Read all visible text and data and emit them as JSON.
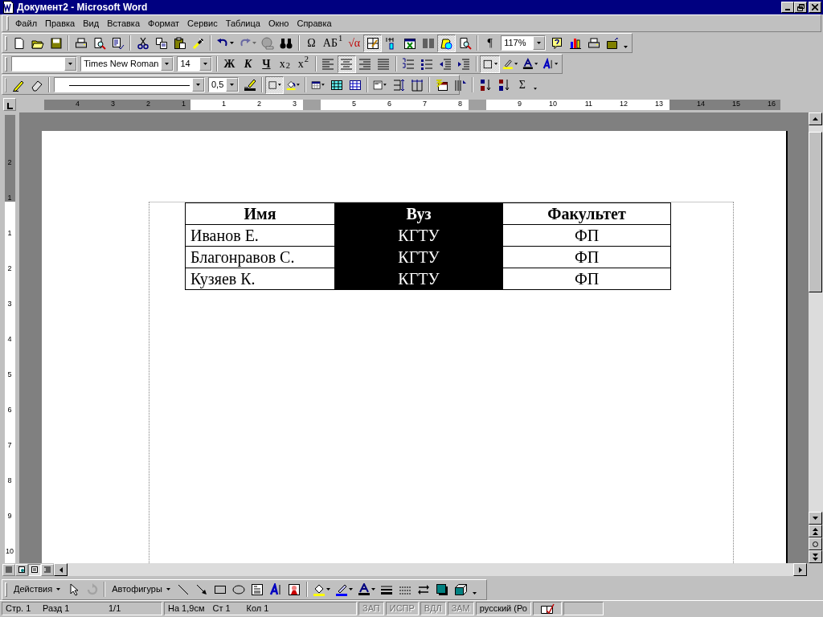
{
  "window": {
    "title": "Документ2 - Microsoft Word"
  },
  "menu": [
    {
      "label": "Файл"
    },
    {
      "label": "Правка"
    },
    {
      "label": "Вид"
    },
    {
      "label": "Вставка"
    },
    {
      "label": "Формат"
    },
    {
      "label": "Сервис"
    },
    {
      "label": "Таблица"
    },
    {
      "label": "Окно"
    },
    {
      "label": "Справка"
    }
  ],
  "toolbars": [
    {
      "items": [
        {
          "kind": "button",
          "pressed": false,
          "disabled": false
        },
        {
          "kind": "button",
          "pressed": false,
          "disabled": false
        },
        {
          "kind": "button",
          "pressed": false,
          "disabled": false
        },
        {
          "kind": "separator"
        },
        {
          "kind": "button",
          "pressed": false,
          "disabled": false
        },
        {
          "kind": "button",
          "pressed": false,
          "disabled": false
        },
        {
          "kind": "button",
          "pressed": false,
          "disabled": false
        },
        {
          "kind": "separator"
        },
        {
          "kind": "button",
          "pressed": false,
          "disabled": false
        },
        {
          "kind": "button",
          "pressed": false,
          "disabled": false
        },
        {
          "kind": "button",
          "pressed": false,
          "disabled": false
        },
        {
          "kind": "button",
          "pressed": false,
          "disabled": false
        },
        {
          "kind": "separator"
        },
        {
          "kind": "split",
          "pressed": false,
          "disabled": false
        },
        {
          "kind": "split",
          "pressed": false,
          "disabled": true
        },
        {
          "kind": "button",
          "pressed": false,
          "disabled": true
        },
        {
          "kind": "button",
          "pressed": false,
          "disabled": false
        },
        {
          "kind": "separator"
        },
        {
          "kind": "text-button",
          "label": "Ω",
          "pressed": false,
          "disabled": false
        },
        {
          "kind": "text-button",
          "label": "АБ$^{1}$",
          "pressed": false,
          "disabled": false
        },
        {
          "kind": "text-button",
          "label": "√α",
          "pressed": false,
          "disabled": false
        },
        {
          "kind": "button",
          "pressed": true,
          "disabled": false
        },
        {
          "kind": "button",
          "pressed": false,
          "disabled": false
        },
        {
          "kind": "button",
          "pressed": false,
          "disabled": false
        },
        {
          "kind": "button",
          "pressed": false,
          "disabled": false
        },
        {
          "kind": "button",
          "pressed": true,
          "disabled": false
        },
        {
          "kind": "button",
          "pressed": false,
          "disabled": false
        },
        {
          "kind": "separator"
        },
        {
          "kind": "text-button",
          "label": "¶",
          "pressed": false,
          "disabled": false
        },
        {
          "kind": "combo",
          "value": "117%"
        },
        {
          "kind": "button",
          "pressed": false,
          "disabled": false
        },
        {
          "kind": "button",
          "pressed": false,
          "disabled": false
        },
        {
          "kind": "button",
          "pressed": false,
          "disabled": false
        },
        {
          "kind": "button",
          "pressed": false,
          "disabled": false
        },
        {
          "kind": "more"
        }
      ]
    },
    {
      "items": [
        {
          "kind": "combo"
        },
        {
          "kind": "combo",
          "value": "Times New Roman"
        },
        {
          "kind": "combo",
          "value": "14"
        },
        {
          "kind": "separator"
        },
        {
          "kind": "text-button",
          "label": "Ж",
          "pressed": false,
          "disabled": false
        },
        {
          "kind": "text-button",
          "label": "К",
          "pressed": false,
          "disabled": false
        },
        {
          "kind": "text-button",
          "label": "Ч",
          "pressed": false,
          "disabled": false
        },
        {
          "kind": "text-button",
          "label": "x$_{2}$",
          "pressed": false,
          "disabled": false
        },
        {
          "kind": "text-button",
          "label": "x$^{2}$",
          "pressed": false,
          "disabled": false
        },
        {
          "kind": "separator"
        },
        {
          "kind": "button",
          "pressed": false,
          "disabled": false
        },
        {
          "kind": "button",
          "pressed": true,
          "disabled": false
        },
        {
          "kind": "button",
          "pressed": false,
          "disabled": false
        },
        {
          "kind": "button",
          "pressed": false,
          "disabled": false
        },
        {
          "kind": "separator"
        },
        {
          "kind": "button",
          "pressed": false,
          "disabled": false
        },
        {
          "kind": "button",
          "pressed": false,
          "disabled": false
        },
        {
          "kind": "button",
          "pressed": false,
          "disabled": false
        },
        {
          "kind": "button",
          "pressed": false,
          "disabled": false
        },
        {
          "kind": "separator"
        },
        {
          "kind": "split",
          "pressed": true,
          "disabled": false
        },
        {
          "kind": "split",
          "pressed": false,
          "disabled": false
        },
        {
          "kind": "split",
          "pressed": false,
          "disabled": false
        },
        {
          "kind": "split",
          "pressed": false,
          "disabled": false
        }
      ]
    },
    {
      "items": [
        {
          "kind": "button",
          "pressed": false,
          "disabled": false
        },
        {
          "kind": "button",
          "pressed": false,
          "disabled": false
        },
        {
          "kind": "separator"
        },
        {
          "kind": "line-combo"
        },
        {
          "kind": "combo",
          "value": "0,5"
        },
        {
          "kind": "button",
          "pressed": false,
          "disabled": false
        },
        {
          "kind": "separator"
        },
        {
          "kind": "split",
          "pressed": true,
          "disabled": false
        },
        {
          "kind": "split",
          "pressed": false,
          "disabled": false
        },
        {
          "kind": "separator"
        },
        {
          "kind": "split",
          "pressed": false,
          "disabled": false
        },
        {
          "kind": "button",
          "pressed": false,
          "disabled": false
        },
        {
          "kind": "button",
          "pressed": false,
          "disabled": false
        },
        {
          "kind": "separator"
        },
        {
          "kind": "split",
          "pressed": false,
          "disabled": false
        },
        {
          "kind": "button",
          "pressed": false,
          "disabled": false
        },
        {
          "kind": "button",
          "pressed": false,
          "disabled": false
        },
        {
          "kind": "separator"
        },
        {
          "kind": "button",
          "pressed": false,
          "disabled": false
        },
        {
          "kind": "button",
          "pressed": false,
          "disabled": false
        },
        {
          "kind": "separator"
        },
        {
          "kind": "button",
          "pressed": false,
          "disabled": false
        },
        {
          "kind": "button",
          "pressed": false,
          "disabled": false
        },
        {
          "kind": "text-button",
          "label": "Σ",
          "pressed": false,
          "disabled": false
        },
        {
          "kind": "more"
        }
      ]
    }
  ],
  "ruler": {
    "segments": [
      {
        "kind": "margin",
        "labels": [
          "4",
          "3",
          "2",
          "1"
        ]
      },
      {
        "kind": "text",
        "labels": [
          "1",
          "2",
          "3"
        ]
      },
      {
        "kind": "marker"
      },
      {
        "kind": "text",
        "labels": [
          "5",
          "6",
          "7",
          "8"
        ]
      },
      {
        "kind": "marker"
      },
      {
        "kind": "text",
        "labels": [
          "9",
          "10",
          "11",
          "12",
          "13"
        ]
      },
      {
        "kind": "margin",
        "labels": [
          "14",
          "15",
          "16"
        ]
      }
    ]
  },
  "vertical_ruler": {
    "segments": [
      {
        "kind": "margin",
        "labels": [
          "2",
          "1"
        ]
      },
      {
        "kind": "text",
        "labels": [
          "1",
          "2",
          "3",
          "4",
          "5",
          "6",
          "7",
          "8",
          "9",
          "10"
        ]
      }
    ]
  },
  "table": {
    "columns": [
      {
        "header": "Имя",
        "selected": false
      },
      {
        "header": "Вуз",
        "selected": true
      },
      {
        "header": "Факультет",
        "selected": false
      }
    ],
    "rows": [
      [
        "Иванов Е.",
        "КГТУ",
        "ФП"
      ],
      [
        "Благонравов С.",
        "КГТУ",
        "ФП"
      ],
      [
        "Кузяев К.",
        "КГТУ",
        "ФП"
      ]
    ]
  },
  "view_buttons": [
    {
      "selected": false
    },
    {
      "selected": false
    },
    {
      "selected": true
    },
    {
      "selected": false
    }
  ],
  "drawing_toolbar": {
    "items": [
      {
        "kind": "menu-button",
        "label": "Действия"
      },
      {
        "kind": "button",
        "pressed": false,
        "disabled": false
      },
      {
        "kind": "button",
        "pressed": false,
        "disabled": true
      },
      {
        "kind": "separator"
      },
      {
        "kind": "menu-button",
        "label": "Автофигуры"
      },
      {
        "kind": "button",
        "pressed": false,
        "disabled": false
      },
      {
        "kind": "button",
        "pressed": false,
        "disabled": false
      },
      {
        "kind": "button",
        "pressed": false,
        "disabled": false
      },
      {
        "kind": "button",
        "pressed": false,
        "disabled": false
      },
      {
        "kind": "button",
        "pressed": false,
        "disabled": false
      },
      {
        "kind": "button",
        "pressed": false,
        "disabled": false
      },
      {
        "kind": "button",
        "pressed": false,
        "disabled": false
      },
      {
        "kind": "separator"
      },
      {
        "kind": "split",
        "pressed": false,
        "disabled": false
      },
      {
        "kind": "split",
        "pressed": false,
        "disabled": false
      },
      {
        "kind": "split",
        "pressed": false,
        "disabled": false
      },
      {
        "kind": "button",
        "pressed": false,
        "disabled": false
      },
      {
        "kind": "button",
        "pressed": false,
        "disabled": false
      },
      {
        "kind": "button",
        "pressed": false,
        "disabled": false
      },
      {
        "kind": "button",
        "pressed": false,
        "disabled": false
      },
      {
        "kind": "button",
        "pressed": false,
        "disabled": false
      },
      {
        "kind": "more"
      }
    ]
  },
  "status_bar": {
    "groups": [
      {
        "items": [
          {
            "text": "Стр. 1",
            "disabled": false
          },
          {
            "text": "Разд 1",
            "disabled": false
          },
          {
            "text": "1/1",
            "disabled": false
          }
        ]
      },
      {
        "items": [
          {
            "text": "На 1,9см",
            "disabled": false
          },
          {
            "text": "Ст 1",
            "disabled": false
          },
          {
            "text": "Кол 1",
            "disabled": false
          }
        ]
      },
      {
        "items": [
          {
            "text": "ЗАП",
            "disabled": true
          },
          {
            "text": "ИСПР",
            "disabled": true
          },
          {
            "text": "ВДЛ",
            "disabled": true
          },
          {
            "text": "ЗАМ",
            "disabled": true
          },
          {
            "text": "русский (Ро",
            "disabled": false
          }
        ]
      }
    ]
  }
}
